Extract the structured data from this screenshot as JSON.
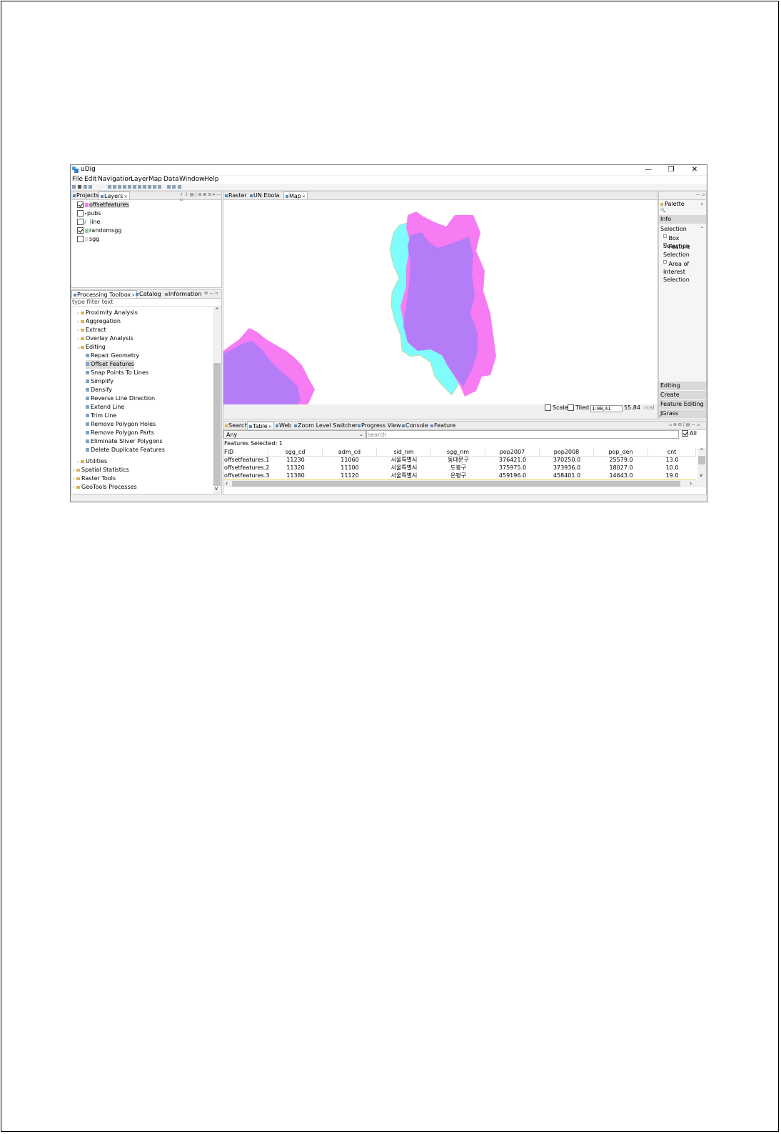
{
  "window": {
    "title": "uDig",
    "minimize": "—",
    "maximize": "❐",
    "close": "✕"
  },
  "menu": [
    "File",
    "Edit",
    "Navigation",
    "Layer",
    "Map",
    "Data",
    "Window",
    "Help"
  ],
  "layers_panel": {
    "tabs": [
      {
        "label": "Projects"
      },
      {
        "label": "Layers"
      }
    ],
    "layers": [
      {
        "name": "offsetfeatures",
        "checked": true
      },
      {
        "name": "pubs",
        "checked": false
      },
      {
        "name": "line",
        "checked": false
      },
      {
        "name": "randomsgg",
        "checked": true
      },
      {
        "name": "sgg",
        "checked": false
      }
    ]
  },
  "toolbox_panel": {
    "tabs": [
      {
        "label": "Processing Toolbox"
      },
      {
        "label": "Catalog"
      },
      {
        "label": "Information"
      }
    ],
    "filter_placeholder": "type filter text",
    "groups": [
      {
        "label": "Proximity Analysis"
      },
      {
        "label": "Aggregation"
      },
      {
        "label": "Extract"
      },
      {
        "label": "Overlay Analysis"
      },
      {
        "label": "Editing"
      }
    ],
    "editing_tools": [
      "Repair Geometry",
      "Offset Features",
      "Snap Points To Lines",
      "Simplify",
      "Densify",
      "Reverse Line Direction",
      "Extend Line",
      "Trim Line",
      "Remove Polygon Holes",
      "Remove Polygon Parts",
      "Eliminate Sliver Polygons",
      "Delete Duplicate Features"
    ],
    "more_groups": [
      "Utilities",
      "Spatial Statistics",
      "Raster Tools",
      "GeoTools Processes"
    ]
  },
  "map_tabs": [
    {
      "label": "Raster"
    },
    {
      "label": "UN Ebola"
    },
    {
      "label": "Map"
    }
  ],
  "map_status": {
    "scale_label": "Scale",
    "tiled_label": "Tiled",
    "scale_value": "1:98,41",
    "crs_text": "55.84",
    "crs_tail": "rcal"
  },
  "palette": {
    "title": "Palette",
    "info": "Info",
    "selection": "Selection",
    "selection_items": [
      "Box Selection",
      "Feature Selection",
      "Area of Interest Selection"
    ],
    "bottom": [
      "Editing",
      "Create",
      "Feature Editing",
      "JGrass"
    ]
  },
  "bottom_tabs": [
    {
      "label": "Search"
    },
    {
      "label": "Table"
    },
    {
      "label": "Web"
    },
    {
      "label": "Zoom Level Switcher"
    },
    {
      "label": "Progress View"
    },
    {
      "label": "Console"
    },
    {
      "label": "Feature"
    }
  ],
  "table_view": {
    "filter_value": "Any",
    "search_placeholder": "search",
    "all_label": "All",
    "features_selected": "Features Selected: 1",
    "columns": [
      "FID",
      "sgg_cd",
      "adm_cd",
      "sid_nm",
      "sgg_nm",
      "pop2007",
      "pop2008",
      "pop_den",
      "cnt"
    ],
    "rows": [
      [
        "offsetfeatures.1",
        "11230",
        "11060",
        "서울특별시",
        "동대문구",
        "376421.0",
        "370250.0",
        "25579.0",
        "13.0"
      ],
      [
        "offsetfeatures.2",
        "11320",
        "11100",
        "서울특별시",
        "도봉구",
        "375975.0",
        "373936.0",
        "18027.0",
        "10.0"
      ],
      [
        "offsetfeatures.3",
        "11380",
        "11120",
        "서울특별시",
        "은평구",
        "459196.0",
        "458401.0",
        "14643.0",
        "19.0"
      ]
    ]
  },
  "colors": {
    "cyan": "#7ffcfc",
    "magenta": "#f77cf3",
    "purple": "#b57cf7"
  }
}
